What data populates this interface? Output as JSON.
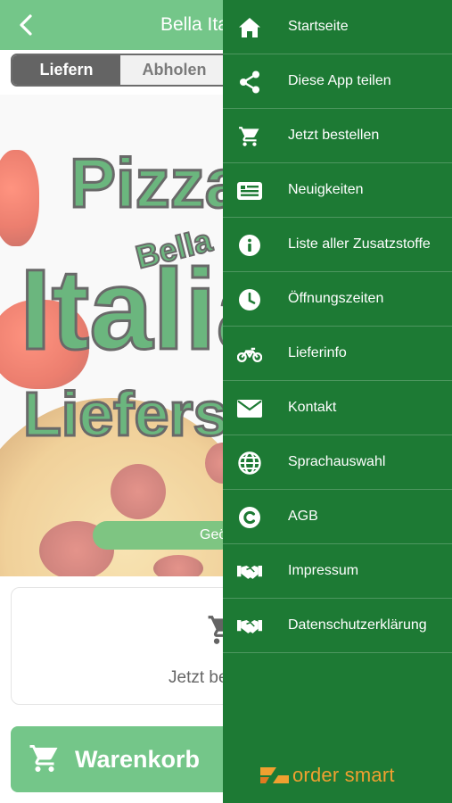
{
  "header": {
    "title": "Bella Italia"
  },
  "segment": {
    "deliver": "Liefern",
    "pickup": "Abholen"
  },
  "hero": {
    "logo_line1": "Pizza",
    "logo_line2": "Bella",
    "logo_line3": "Italia",
    "logo_line4": "Lieferservice",
    "status_label": "Geöffnet"
  },
  "order_card": {
    "label": "Jetzt bestellen"
  },
  "basket": {
    "label": "Warenkorb"
  },
  "drawer": {
    "items": [
      {
        "label": "Startseite",
        "icon": "home-icon"
      },
      {
        "label": "Diese App teilen",
        "icon": "share-icon"
      },
      {
        "label": "Jetzt bestellen",
        "icon": "cart-icon"
      },
      {
        "label": "Neuigkeiten",
        "icon": "news-icon"
      },
      {
        "label": "Liste aller Zusatzstoffe",
        "icon": "info-icon"
      },
      {
        "label": "Öffnungszeiten",
        "icon": "clock-icon"
      },
      {
        "label": "Lieferinfo",
        "icon": "motorbike-icon"
      },
      {
        "label": "Kontakt",
        "icon": "mail-icon"
      },
      {
        "label": "Sprachauswahl",
        "icon": "globe-icon"
      },
      {
        "label": "AGB",
        "icon": "copyright-icon"
      },
      {
        "label": "Impressum",
        "icon": "handshake-icon"
      },
      {
        "label": "Datenschutzerklärung",
        "icon": "handshake-icon"
      }
    ],
    "footer": "order smart"
  },
  "colors": {
    "brand_green": "#2aa84a",
    "drawer_green": "#1d7a34",
    "accent_orange": "#f0a030"
  }
}
